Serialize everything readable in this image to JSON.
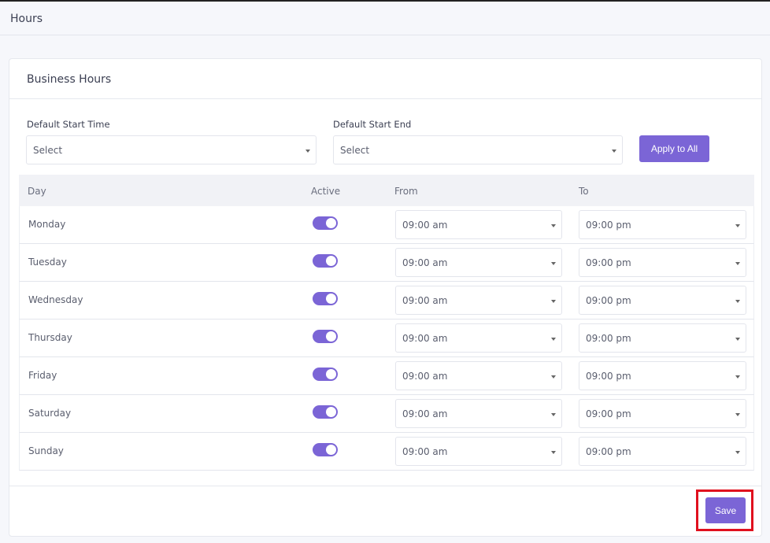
{
  "page": {
    "title": "Hours"
  },
  "card": {
    "title": "Business Hours"
  },
  "defaults": {
    "start_label": "Default Start Time",
    "start_value": "Select",
    "end_label": "Default Start End",
    "end_value": "Select",
    "apply_label": "Apply to All"
  },
  "table": {
    "headers": {
      "day": "Day",
      "active": "Active",
      "from": "From",
      "to": "To"
    },
    "rows": [
      {
        "day": "Monday",
        "active": true,
        "from": "09:00 am",
        "to": "09:00 pm"
      },
      {
        "day": "Tuesday",
        "active": true,
        "from": "09:00 am",
        "to": "09:00 pm"
      },
      {
        "day": "Wednesday",
        "active": true,
        "from": "09:00 am",
        "to": "09:00 pm"
      },
      {
        "day": "Thursday",
        "active": true,
        "from": "09:00 am",
        "to": "09:00 pm"
      },
      {
        "day": "Friday",
        "active": true,
        "from": "09:00 am",
        "to": "09:00 pm"
      },
      {
        "day": "Saturday",
        "active": true,
        "from": "09:00 am",
        "to": "09:00 pm"
      },
      {
        "day": "Sunday",
        "active": true,
        "from": "09:00 am",
        "to": "09:00 pm"
      }
    ]
  },
  "footer": {
    "save_label": "Save"
  },
  "colors": {
    "accent": "#7b65d6",
    "highlight": "#e0101e"
  },
  "icons": {
    "select_caret": "caret-down-icon"
  }
}
